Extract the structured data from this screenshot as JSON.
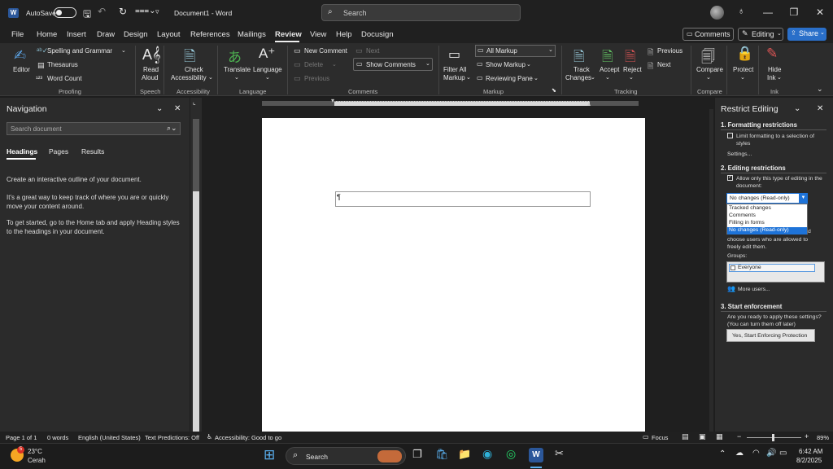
{
  "titlebar": {
    "autosave_label": "AutoSave",
    "doc_title": "Document1  -  Word",
    "search_placeholder": "Search"
  },
  "menu": {
    "items": [
      "File",
      "Home",
      "Insert",
      "Draw",
      "Design",
      "Layout",
      "References",
      "Mailings",
      "Review",
      "View",
      "Help",
      "Docusign"
    ],
    "active": "Review",
    "comments_btn": "Comments",
    "editing_btn": "Editing",
    "share_btn": "Share"
  },
  "ribbon": {
    "editor": "Editor",
    "spelling": "Spelling and Grammar",
    "thesaurus": "Thesaurus",
    "word_count": "Word Count",
    "proofing": "Proofing",
    "read_aloud_1": "Read",
    "read_aloud_2": "Aloud",
    "speech": "Speech",
    "check_acc_1": "Check",
    "check_acc_2": "Accessibility",
    "accessibility": "Accessibility",
    "translate": "Translate",
    "language_btn": "Language",
    "language_grp": "Language",
    "new_comment": "New Comment",
    "next": "Next",
    "delete": "Delete",
    "previous": "Previous",
    "show_comments": "Show Comments",
    "comments_grp": "Comments",
    "filter_1": "Filter All",
    "filter_2": "Markup",
    "all_markup": "All Markup",
    "show_markup": "Show Markup",
    "reviewing_pane": "Reviewing Pane",
    "markup_grp": "Markup",
    "track_1": "Track",
    "track_2": "Changes",
    "accept": "Accept",
    "reject": "Reject",
    "t_previous": "Previous",
    "t_next": "Next",
    "tracking_grp": "Tracking",
    "compare_btn": "Compare",
    "compare_grp": "Compare",
    "protect": "Protect",
    "hide_1": "Hide",
    "hide_2": "Ink",
    "ink_grp": "Ink"
  },
  "nav": {
    "title": "Navigation",
    "search_placeholder": "Search document",
    "tabs": [
      "Headings",
      "Pages",
      "Results"
    ],
    "active_tab": "Headings",
    "p1": "Create an interactive outline of your document.",
    "p2a": "It's a great way to keep track of where you are or quickly",
    "p2b": "move your content around.",
    "p3a": "To get started, go to the Home tab and apply Heading styles",
    "p3b": "to the headings in your document."
  },
  "restrict": {
    "title": "Restrict Editing",
    "s1": "1. Formatting restrictions",
    "limit_a": "Limit formatting to a selection of",
    "limit_b": "styles",
    "settings": "Settings...",
    "s2": "2. Editing restrictions",
    "allow_a": "Allow only this type of editing in the",
    "allow_b": "document:",
    "dropdown_value": "No changes (Read-only)",
    "options": [
      "Tracked changes",
      "Comments",
      "Filling in forms",
      "No changes (Read-only)"
    ],
    "exc_a": "d",
    "exc_b": "choose users who are allowed to",
    "exc_c": "freely edit them.",
    "groups": "Groups:",
    "everyone": "Everyone",
    "more_users": "More users...",
    "s3": "3. Start enforcement",
    "ready_a": "Are you ready to apply these settings?",
    "ready_b": "(You can turn them off later)",
    "start_btn": "Yes, Start Enforcing Protection"
  },
  "status": {
    "page": "Page 1 of 1",
    "words": "0 words",
    "lang": "English (United States)",
    "predictions": "Text Predictions: Off",
    "accessibility": "Accessibility: Good to go",
    "focus": "Focus",
    "zoom": "89%"
  },
  "taskbar": {
    "temp": "23°C",
    "weather": "Cerah",
    "badge": "5",
    "search": "Search",
    "time": "6:42 AM",
    "date": "8/2/2025"
  },
  "doc": {
    "pilcrow": "¶"
  },
  "colors": {
    "accent": "#2b579a",
    "blue_highlight": "#1e73d8",
    "page": "#ffffff"
  }
}
